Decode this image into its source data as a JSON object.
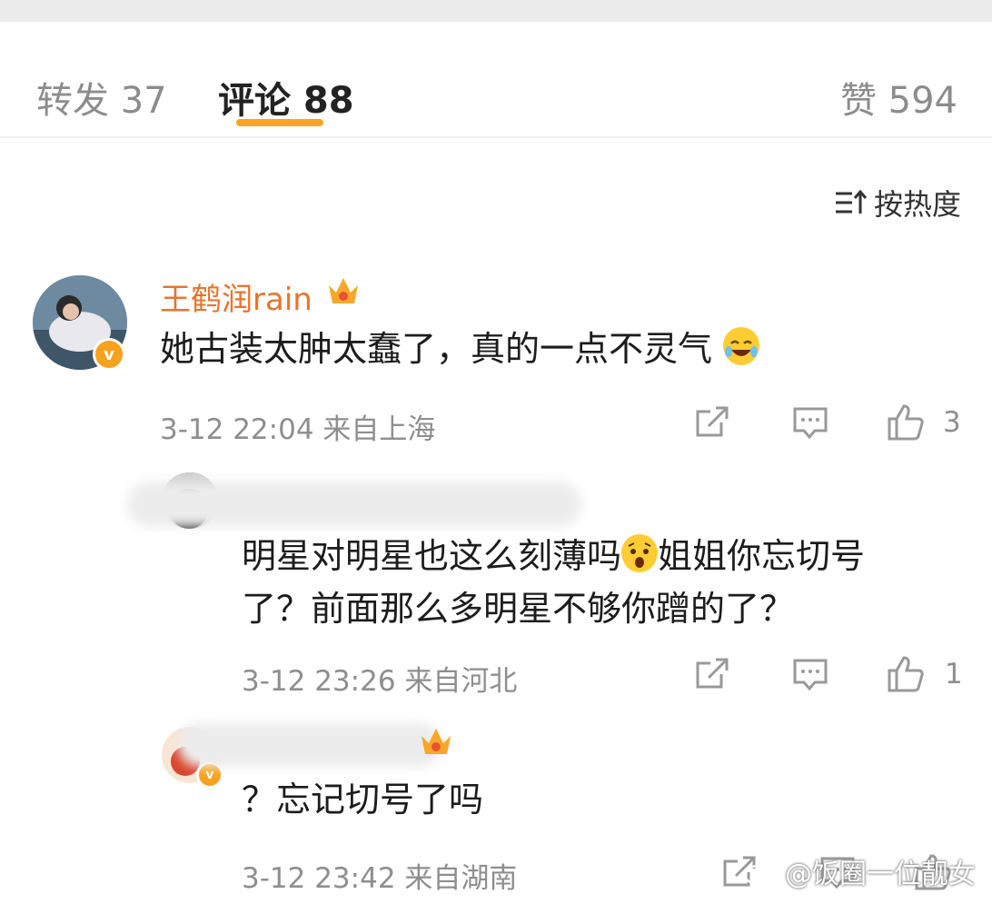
{
  "tabs": {
    "repost": "转发 37",
    "comments": "评论 88",
    "likes": "赞 594"
  },
  "sort": {
    "label": "按热度"
  },
  "comments": [
    {
      "username": "王鹤润rain",
      "text": "她古装太肿太蠢了，真的一点不灵气",
      "meta": "3-12 22:04  来自上海",
      "likes": "3"
    },
    {
      "username": "",
      "text_line1": "明星对明星也这么刻薄吗",
      "text_line1b": "姐姐你忘切号",
      "text_line2": "了？前面那么多明星不够你蹭的了？",
      "meta": "3-12 23:26  来自河北",
      "likes": "1"
    },
    {
      "username": "",
      "text": "？忘记切号了吗",
      "meta": "3-12 23:42  来自湖南"
    }
  ],
  "watermark": "@饭圈一位靓女",
  "colors": {
    "accent": "#f5a623",
    "username": "#e8742d",
    "meta": "#8e8e8e"
  }
}
